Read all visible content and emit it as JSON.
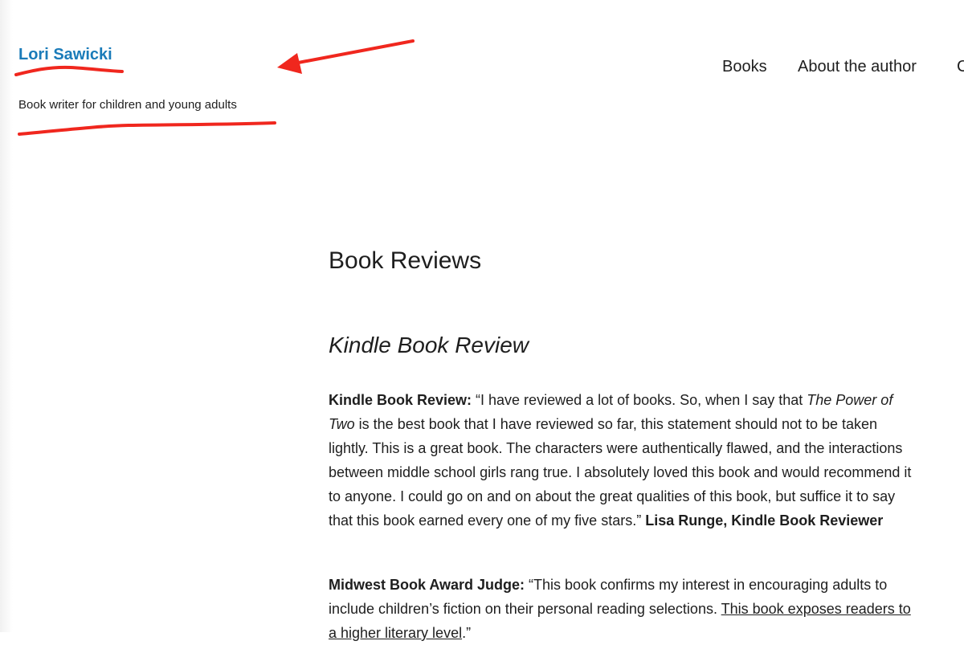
{
  "header": {
    "site_title": "Lori Sawicki",
    "tagline": "Book writer for children and young adults",
    "nav": {
      "books": "Books",
      "about": "About the author",
      "contact_partial": "C"
    }
  },
  "page": {
    "title": "Book Reviews",
    "section_heading": "Kindle Book Review"
  },
  "reviews": [
    {
      "source": "Kindle Book Review:",
      "text_open": " “I have reviewed a lot of books. So, when I say that ",
      "book_title": "The Power of Two",
      "text_close": " is the best book that I have reviewed so far, this statement should not to be taken lightly. This is a great book. The characters were authentically flawed, and the interactions between middle school girls rang true. I absolutely loved this book and would recommend it to anyone. I could go on and on about the great qualities of this book, but suffice it to say that this book earned every one of my five stars.” ",
      "attribution": "Lisa Runge, Kindle Book Reviewer"
    },
    {
      "source": "Midwest Book Award Judge:",
      "text_open": " “This book confirms my interest in encouraging adults to include children’s fiction on their personal reading selections. ",
      "link_text": "This book exposes readers to a higher literary level",
      "text_close": ".”"
    }
  ],
  "annotation": {
    "color": "#f0271e"
  }
}
